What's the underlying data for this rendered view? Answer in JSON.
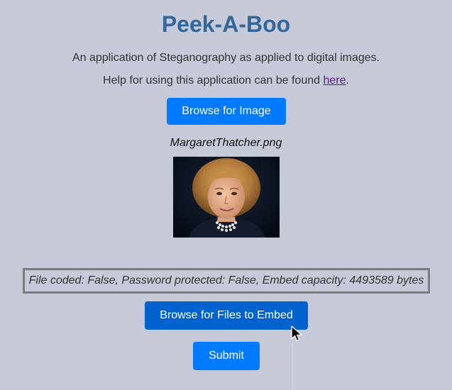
{
  "app": {
    "title": "Peek-A-Boo",
    "subtitle": "An application of Steganography as applied to digital images."
  },
  "help": {
    "prefix": "Help for using this application can be found ",
    "link_label": "here",
    "suffix": "."
  },
  "buttons": {
    "browse_image": "Browse for Image",
    "browse_files": "Browse for Files to Embed",
    "submit": "Submit"
  },
  "image": {
    "filename": "MargaretThatcher.png",
    "subject": "portrait-photo"
  },
  "status": {
    "text": "File coded: False, Password protected: False, Embed capacity: 4493589 bytes"
  },
  "colors": {
    "background": "#c5c9d8",
    "title": "#336699",
    "button": "#007bff",
    "button_active": "#0062cc",
    "link": "#551a8b"
  },
  "icons": {
    "cursor": "mouse-pointer-icon"
  }
}
